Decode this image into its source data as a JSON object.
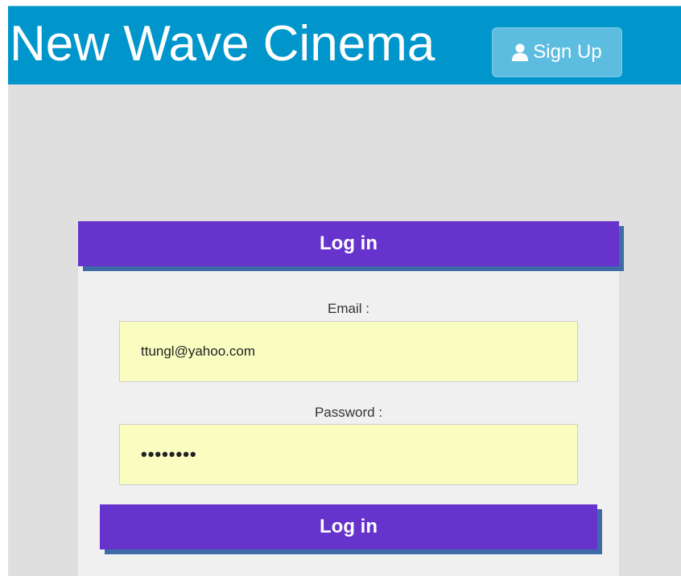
{
  "header": {
    "title": "New Wave Cinema",
    "signup_label": "Sign Up"
  },
  "login_card": {
    "title": "Log in",
    "email_label": "Email :",
    "email_value": "ttungl@yahoo.com",
    "password_label": "Password :",
    "password_masked": "••••••••",
    "submit_label": "Log in"
  },
  "colors": {
    "header_bg": "#0096cc",
    "accent_purple": "#6633cc",
    "input_bg": "#f9fdc0",
    "page_bg": "#dfdfdf"
  }
}
